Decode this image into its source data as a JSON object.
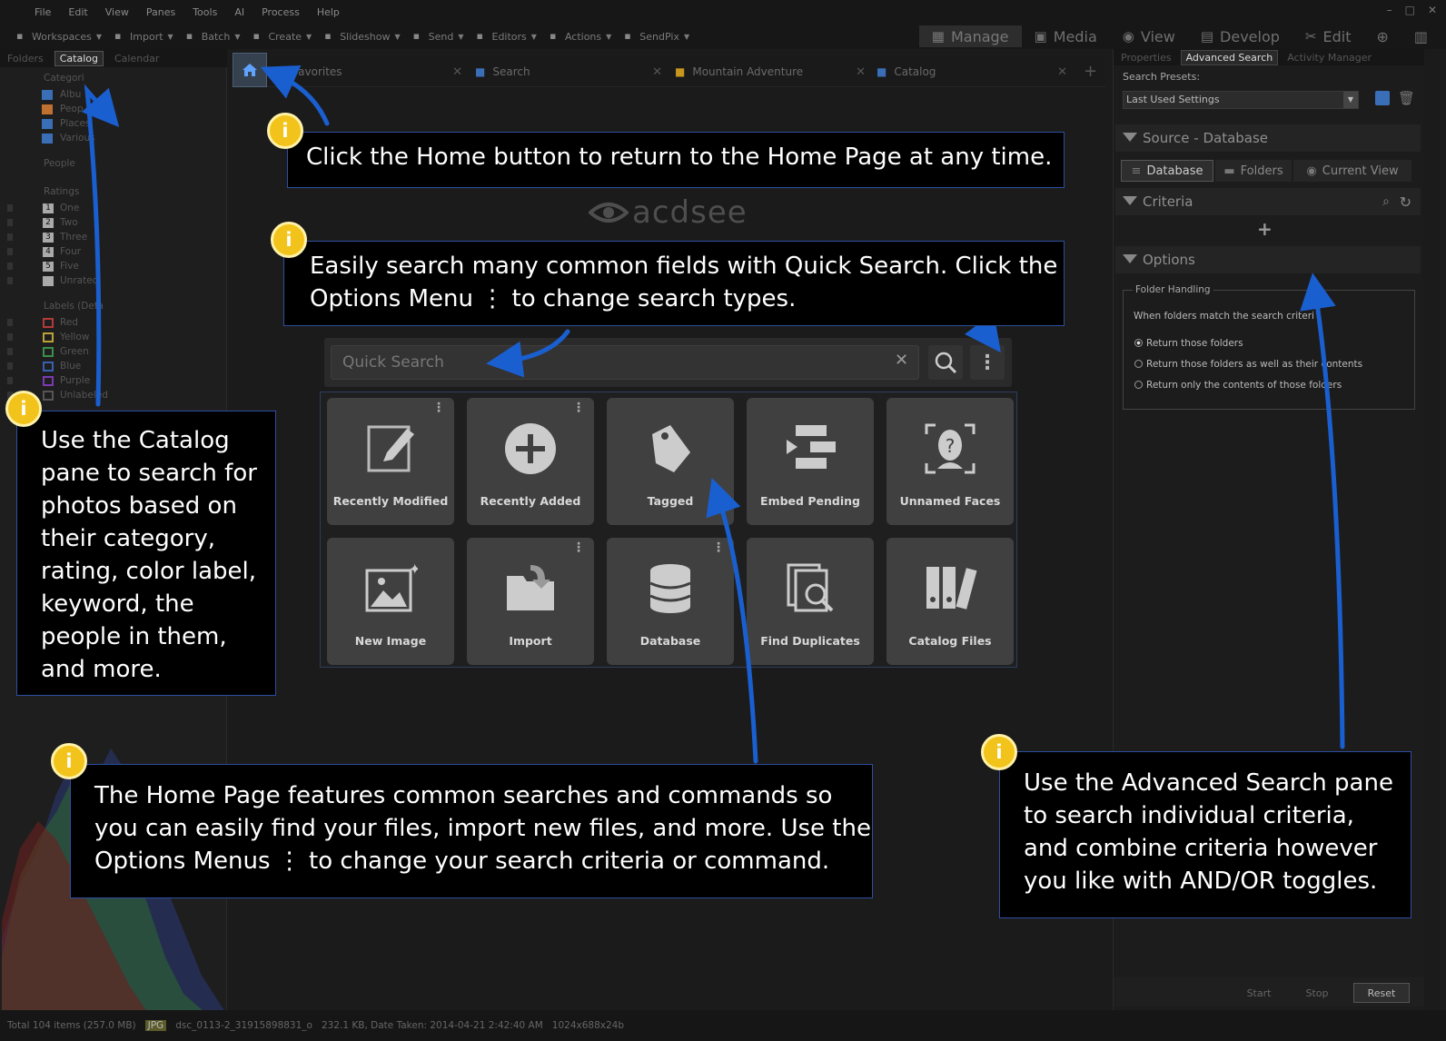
{
  "menu": [
    "File",
    "Edit",
    "View",
    "Panes",
    "Tools",
    "AI",
    "Process",
    "Help"
  ],
  "toolbar": [
    {
      "label": "Workspaces",
      "icon": "workspaces-icon"
    },
    {
      "label": "Import",
      "icon": "import-icon"
    },
    {
      "label": "Batch",
      "icon": "batch-icon"
    },
    {
      "label": "Create",
      "icon": "create-icon"
    },
    {
      "label": "Slideshow",
      "icon": "slideshow-icon"
    },
    {
      "label": "Send",
      "icon": "send-icon"
    },
    {
      "label": "Editors",
      "icon": "editors-icon"
    },
    {
      "label": "Actions",
      "icon": "actions-icon"
    },
    {
      "label": "SendPix",
      "icon": "sendpix-icon"
    }
  ],
  "modes": [
    {
      "label": "Manage",
      "active": true
    },
    {
      "label": "Media"
    },
    {
      "label": "View"
    },
    {
      "label": "Develop"
    },
    {
      "label": "Edit"
    }
  ],
  "left": {
    "tabs": [
      "Folders",
      "Catalog",
      "Calendar"
    ],
    "active_tab": "Catalog",
    "categories_header": "Categori",
    "categories": [
      "Albu",
      "Peop",
      "Places",
      "Various"
    ],
    "people_header": "People",
    "ratings_header": "Ratings",
    "ratings": [
      {
        "num": "1",
        "label": "One"
      },
      {
        "num": "2",
        "label": "Two"
      },
      {
        "num": "3",
        "label": "Three"
      },
      {
        "num": "4",
        "label": "Four"
      },
      {
        "num": "5",
        "label": "Five"
      },
      {
        "num": "",
        "label": "Unrated"
      }
    ],
    "labels_header": "Labels (Defa",
    "labels": [
      {
        "label": "Red",
        "color": "#b23a3a"
      },
      {
        "label": "Yellow",
        "color": "#b9a23a"
      },
      {
        "label": "Green",
        "color": "#3a8f4a"
      },
      {
        "label": "Blue",
        "color": "#3a5fb2"
      },
      {
        "label": "Purple",
        "color": "#7a3ab2"
      },
      {
        "label": "Unlabeled",
        "color": "#555555"
      }
    ]
  },
  "tabs": [
    {
      "label": "Favorites"
    },
    {
      "label": "Search"
    },
    {
      "label": "Mountain Adventure"
    },
    {
      "label": "Catalog"
    }
  ],
  "logo": "acdsee",
  "quick_search": {
    "placeholder": "Quick Search"
  },
  "tiles": [
    {
      "label": "Recently Modified",
      "icon": "recently-modified-icon",
      "menu": true
    },
    {
      "label": "Recently Added",
      "icon": "recently-added-icon",
      "menu": true
    },
    {
      "label": "Tagged",
      "icon": "tagged-icon",
      "menu": false
    },
    {
      "label": "Embed Pending",
      "icon": "embed-pending-icon",
      "menu": false
    },
    {
      "label": "Unnamed Faces",
      "icon": "unnamed-faces-icon",
      "menu": false
    },
    {
      "label": "New Image",
      "icon": "new-image-icon",
      "menu": false
    },
    {
      "label": "Import",
      "icon": "import-folder-icon",
      "menu": true
    },
    {
      "label": "Database",
      "icon": "database-icon",
      "menu": true
    },
    {
      "label": "Find Duplicates",
      "icon": "find-duplicates-icon",
      "menu": false
    },
    {
      "label": "Catalog Files",
      "icon": "catalog-files-icon",
      "menu": false
    }
  ],
  "right": {
    "tabs": [
      "Properties",
      "Advanced Search",
      "Activity Manager"
    ],
    "active_tab": "Advanced Search",
    "presets_label": "Search Presets:",
    "preset_value": "Last Used Settings",
    "source_header": "Source - Database",
    "source_options": [
      "Database",
      "Folders",
      "Current View"
    ],
    "criteria_header": "Criteria",
    "options_header": "Options",
    "folder_handling_title": "Folder Handling",
    "folder_handling_text": "When folders match the search criteri",
    "radios": [
      "Return those folders",
      "Return those folders as well as their contents",
      "Return only the contents of those folders"
    ],
    "buttons": [
      "Start",
      "Stop",
      "Reset"
    ]
  },
  "status": {
    "total": "Total 104 items  (257.0 MB)",
    "format": "JPG",
    "filename": "dsc_0113-2_31915898831_o",
    "info": "232.1 KB, Date Taken: 2014-04-21 2:42:40 AM",
    "dims": "1024x688x24b"
  },
  "callouts": {
    "home": "Click the Home button to return to the Home Page at any time.",
    "quicksearch_1": "Easily search many common fields with Quick Search. Click the",
    "quicksearch_2": "Options Menu ⋮ to change search types.",
    "catalog": [
      "Use the Catalog",
      "pane to search for",
      "photos based on",
      "their category,",
      "rating, color label,",
      "keyword, the",
      "people in them,",
      "and more."
    ],
    "homepage": [
      "The Home Page features common searches and commands so",
      "you can easily find your files, import new files, and more. Use the",
      "Options Menus ⋮ to change your search criteria or command."
    ],
    "advanced": [
      "Use the Advanced Search pane",
      "to search individual criteria,",
      "and combine criteria however",
      "you like with AND/OR toggles."
    ]
  },
  "colors": {
    "callout_border": "#2d4fa0",
    "arrow": "#1a5fd0",
    "badge": "#f2c31a",
    "tile": "#404040"
  }
}
